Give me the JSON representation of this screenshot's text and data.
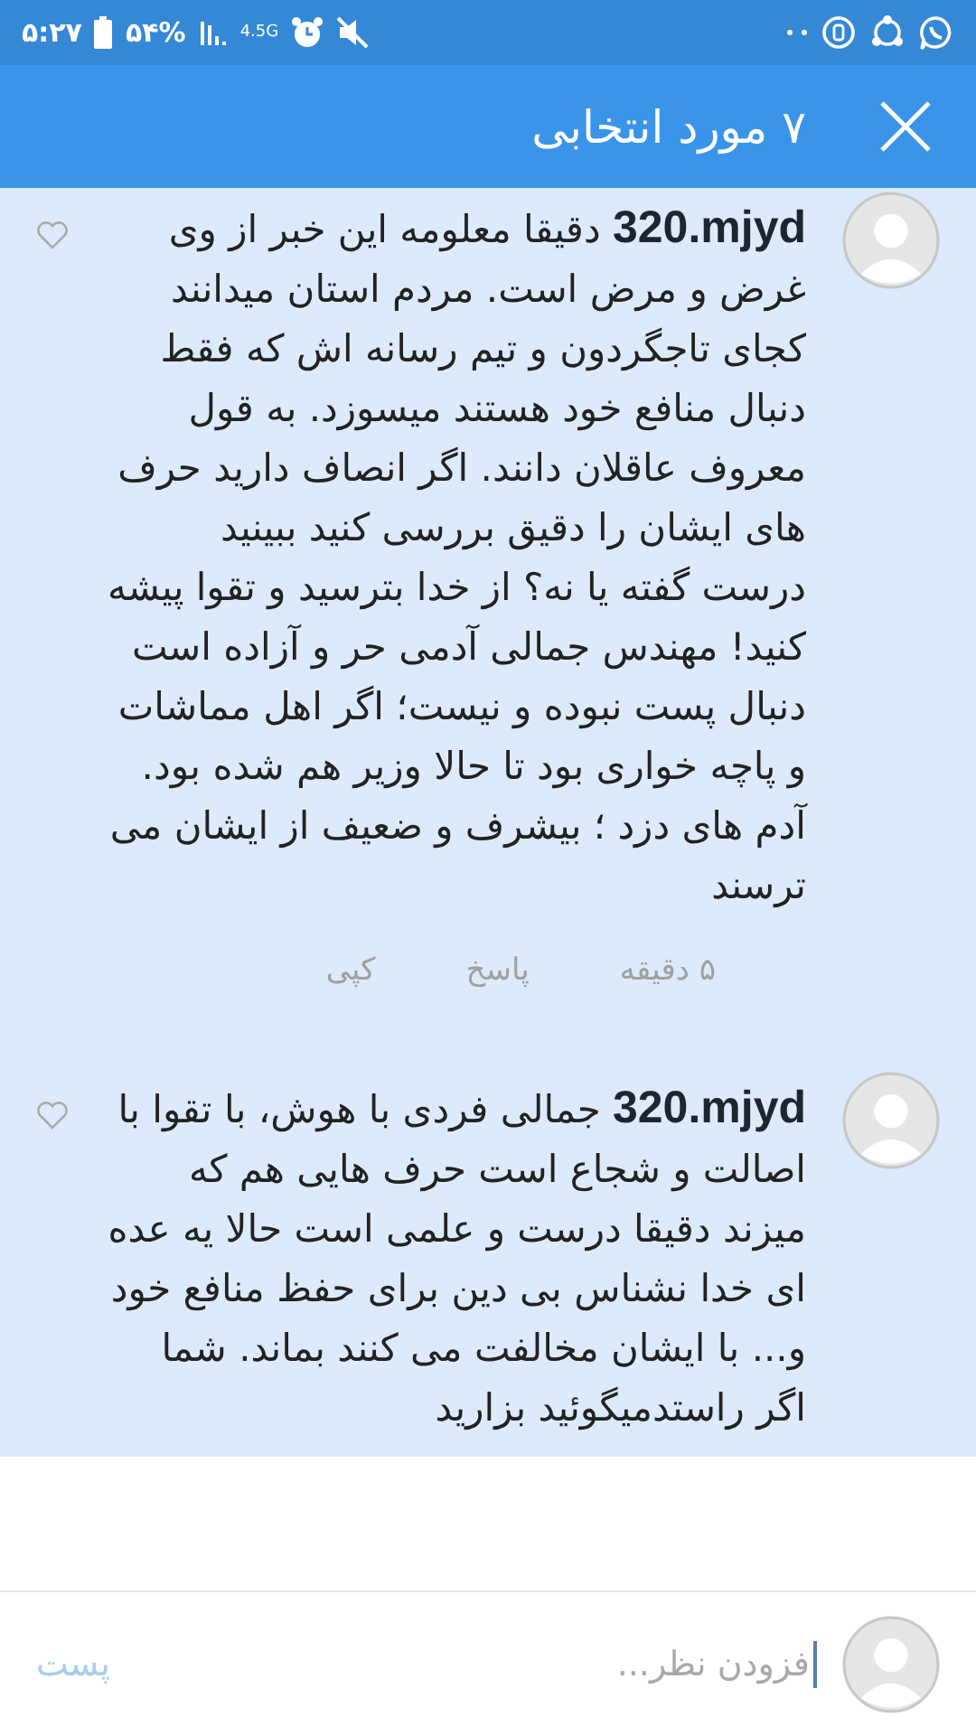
{
  "status_bar": {
    "time": "۵:۲۷",
    "battery": "۵۴%",
    "network": "4.5G"
  },
  "header": {
    "title": "۷ مورد انتخابی"
  },
  "comments": [
    {
      "selected": true,
      "text": "**320.mjyd** دقیقا معلومه این خبر از وی غرض و مرض است. مردم استان میدانند کجای تاجگردون و تیم رسانه اش که فقط دنبال منافع خود هستند میسوزد. به قول معروف عاقلان دانند. اگر انصاف دارید حرف های ایشان را  دقیق بررسی کنید ببینید درست گفته یا نه؟ از خدا بترسید و تقوا پیشه کنید! مهندس جمالی آدمی حر و آزاده است دنبال پست  نبوده و نیست؛ اگر اهل مماشات و پاچه خواری بود تا حالا وزیر هم شده بود. آدم های دزد ؛ بیشرف و ضعیف از ایشان می ترسند",
      "time": "۵ دقیقه",
      "actions": [
        "پاسخ",
        "کپی"
      ]
    },
    {
      "selected": true,
      "text": "**320.mjyd** جمالی فردی با هوش، با تقوا  با اصالت و شجاع است حرف هایی هم که میزند دقیقا درست و علمی است حالا یه عده ای خدا نشناس بی دین برای حفظ منافع خود و... با ایشان مخالفت می کنند بماند. شما اگر راستدمیگوئید بزارید"
    }
  ],
  "composer": {
    "placeholder": "فزودن نظر...",
    "post_button": {
      "label": "پست",
      "disabled": true
    }
  }
}
